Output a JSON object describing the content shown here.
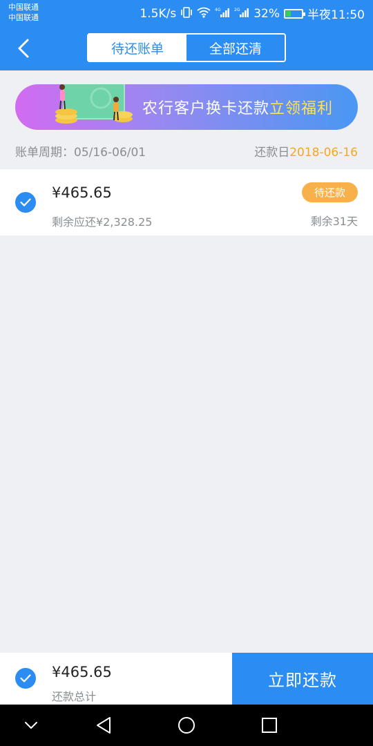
{
  "status_bar": {
    "carrier_1": "中国联通",
    "carrier_2": "中国联通",
    "network_speed": "1.5K/s",
    "signal_1_label": "4G",
    "signal_2_label": "2G",
    "battery_percent": "32%",
    "time": "半夜11:50"
  },
  "nav": {
    "back_icon": "chevron-left-icon",
    "tabs": [
      {
        "label": "待还账单",
        "active": true
      },
      {
        "label": "全部还清",
        "active": false
      }
    ]
  },
  "banner": {
    "text": "农行客户换卡还款",
    "highlight": "立领福利"
  },
  "bill_period": {
    "label": "账单周期：05/16-06/01",
    "due_label": "还款日",
    "due_date": "2018-06-16"
  },
  "bill": {
    "checked": true,
    "amount": "¥465.65",
    "remaining": "剩余应还¥2,328.25",
    "status_badge": "待还款",
    "days_left": "剩余31天"
  },
  "footer": {
    "checked": true,
    "total_amount": "¥465.65",
    "total_label": "还款总计",
    "pay_button": "立即还款"
  },
  "colors": {
    "primary": "#2b8df2",
    "accent_orange": "#f5a623",
    "badge": "#f8b14a",
    "banner_highlight": "#ffe15a"
  }
}
